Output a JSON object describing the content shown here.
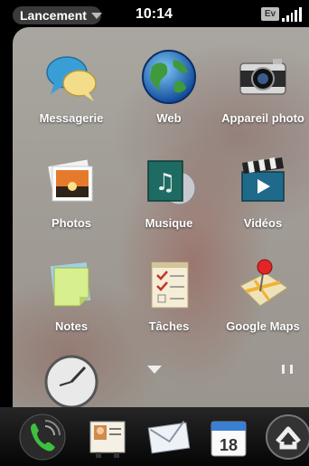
{
  "status_bar": {
    "launcher_menu": "Lancement",
    "time": "10:14",
    "network": "Ev"
  },
  "apps": [
    {
      "label": "Messagerie",
      "icon": "chat-bubbles-icon"
    },
    {
      "label": "Web",
      "icon": "globe-icon"
    },
    {
      "label": "Appareil photo",
      "icon": "camera-icon"
    },
    {
      "label": "Photos",
      "icon": "photo-stack-icon"
    },
    {
      "label": "Musique",
      "icon": "music-icon"
    },
    {
      "label": "Vidéos",
      "icon": "clapperboard-icon"
    },
    {
      "label": "Notes",
      "icon": "sticky-note-icon"
    },
    {
      "label": "Tâches",
      "icon": "checklist-icon"
    },
    {
      "label": "Google Maps",
      "icon": "map-pin-icon"
    },
    {
      "label": "",
      "icon": "clock-icon"
    }
  ],
  "dock": [
    {
      "icon": "phone-icon"
    },
    {
      "icon": "contacts-icon"
    },
    {
      "icon": "email-icon"
    },
    {
      "icon": "calendar-icon",
      "text": "18"
    },
    {
      "icon": "launcher-up-icon"
    }
  ]
}
